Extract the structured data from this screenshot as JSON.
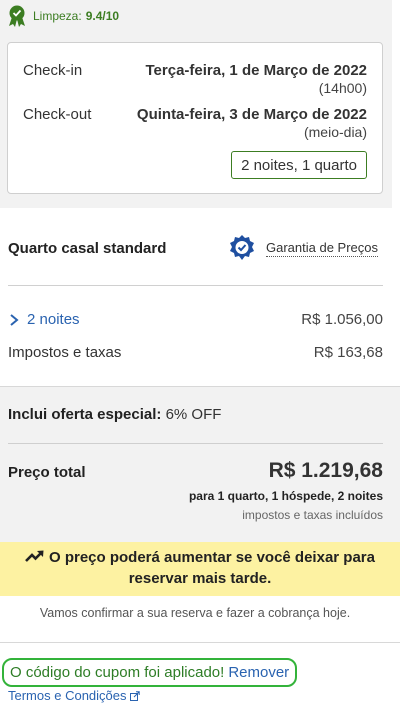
{
  "rating": {
    "label": "Limpeza:",
    "score": "9.4/10",
    "icon": "award-ribbon-icon"
  },
  "stay": {
    "checkin_label": "Check-in",
    "checkin_date": "Terça-feira, 1 de Março de 2022",
    "checkin_time": "(14h00)",
    "checkout_label": "Check-out",
    "checkout_date": "Quinta-feira, 3 de Março de 2022",
    "checkout_time": "(meio-dia)",
    "summary": "2 noites, 1 quarto"
  },
  "room": {
    "title": "Quarto casal standard",
    "guarantee_label": "Garantia de Preços",
    "guarantee_icon": "price-guarantee-badge-icon"
  },
  "prices": {
    "nights_label": "2 noites",
    "nights_value": "R$ 1.056,00",
    "taxes_label": "Impostos e taxas",
    "taxes_value": "R$ 163,68"
  },
  "offer": {
    "label": "Inclui oferta especial:",
    "value": "6% OFF"
  },
  "total": {
    "label": "Preço total",
    "amount": "R$ 1.219,68",
    "detail": "para 1 quarto, 1 hóspede, 2 noites",
    "taxes_note": "impostos e taxas incluídos"
  },
  "warning": {
    "text": "O preço poderá aumentar se você deixar para reservar mais tarde.",
    "icon": "trending-up-icon"
  },
  "confirm_text": "Vamos confirmar a sua reserva e fazer a cobrança hoje.",
  "coupon": {
    "applied_text": "O código do cupom foi aplicado!",
    "remove_label": "Remover"
  },
  "terms": {
    "label": "Termos e Condições",
    "icon": "external-link-icon"
  },
  "colors": {
    "green": "#3c7d22",
    "link_blue": "#2a63b0",
    "warning_yellow": "#fdf2a2",
    "panel_gray": "#f2f2f2",
    "coupon_border": "#33b33a"
  }
}
